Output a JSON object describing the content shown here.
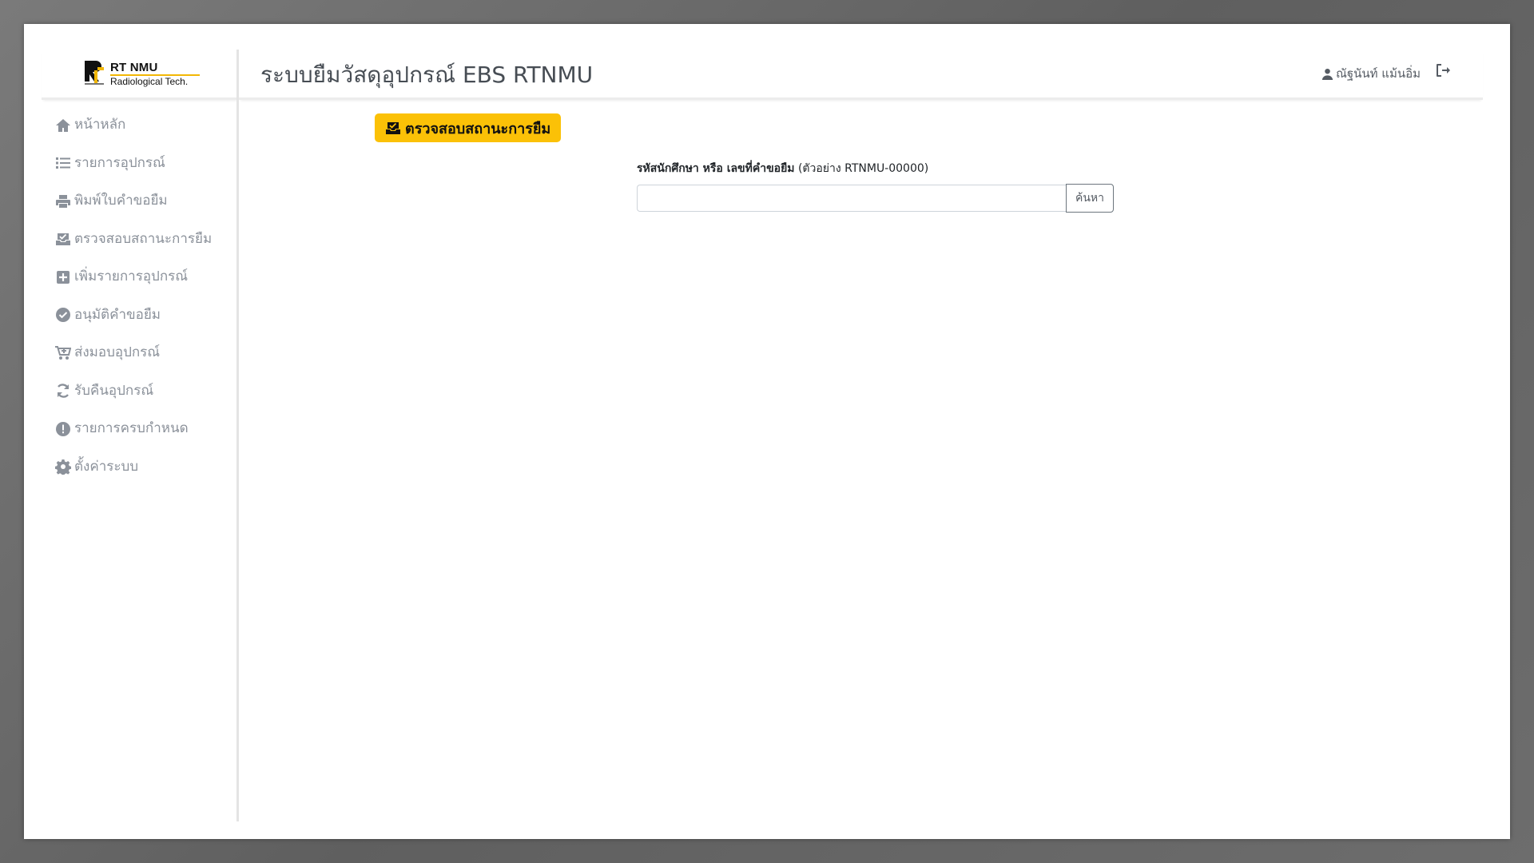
{
  "app": {
    "title": "ระบบยืมวัสดุอุปกรณ์ EBS RTNMU",
    "logo": {
      "title": "RT NMU",
      "subtitle": "Radiological Tech."
    }
  },
  "header": {
    "user_name": "ณัฐนันท์ แม้นอิ่ม",
    "logout_icon": "logout-icon"
  },
  "sidebar": {
    "items": [
      {
        "label": "หน้าหลัก",
        "icon": "home-icon"
      },
      {
        "label": "รายการอุปกรณ์",
        "icon": "list-icon"
      },
      {
        "label": "พิมพ์ใบคำขอยืม",
        "icon": "printer-icon"
      },
      {
        "label": "ตรวจสอบสถานะการยืม",
        "icon": "inbox-check-icon"
      },
      {
        "label": "เพิ่มรายการอุปกรณ์",
        "icon": "plus-square-icon"
      },
      {
        "label": "อนุมัติคำขอยืม",
        "icon": "check-circle-icon"
      },
      {
        "label": "ส่งมอบอุปกรณ์",
        "icon": "cart-plus-icon"
      },
      {
        "label": "รับคืนอุปกรณ์",
        "icon": "sync-icon"
      },
      {
        "label": "รายการครบกำหนด",
        "icon": "exclamation-circle-icon"
      },
      {
        "label": "ตั้งค่าระบบ",
        "icon": "gear-icon"
      }
    ]
  },
  "main": {
    "section_title": "ตรวจสอบสถานะการยืม",
    "search": {
      "label_bold": "รหัสนักศึกษา หรือ เลขที่คำขอยืม",
      "label_hint": "(ตัวอย่าง RTNMU-00000)",
      "value": "",
      "placeholder": "",
      "button_label": "ค้นหา"
    }
  },
  "colors": {
    "accent": "#fbc107",
    "sidebar_text": "#8b919a",
    "title_text": "#474d54"
  }
}
